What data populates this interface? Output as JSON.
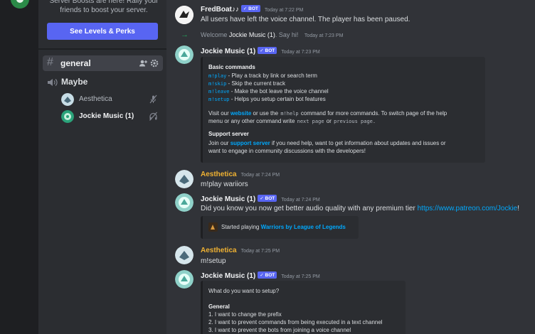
{
  "sidebar": {
    "boost_text_line1": "Server Boosts are here! Rally your",
    "boost_text_line2": "friends to boost your server.",
    "boost_button": "See Levels & Perks",
    "text_channel": "general",
    "voice_channel": "Maybe",
    "voice_users": [
      {
        "name": "Aesthetica",
        "color": "#b5bac1"
      },
      {
        "name": "Jockie Music (1)",
        "color": "#f2f3f5"
      }
    ]
  },
  "chat": {
    "bot_tag": "✓ BOT",
    "fredboat": {
      "name": "FredBoat♪♪",
      "time": "Today at 7:22 PM",
      "text": "All users have left the voice channel. The player has been paused."
    },
    "join": {
      "prefix": "Welcome",
      "name": "Jockie Music (1)",
      "suffix": ". Say hi!",
      "time": "Today at 7:23 PM"
    },
    "jockie1": {
      "name": "Jockie Music (1)",
      "time": "Today at 7:23 PM",
      "basic_title": "Basic commands",
      "cmds": [
        {
          "code": "m!play",
          "desc": " - Play a track by link or search term"
        },
        {
          "code": "m!skip",
          "desc": " - Skip the current track"
        },
        {
          "code": "m!leave",
          "desc": " - Make the bot leave the voice channel"
        },
        {
          "code": "m!setup",
          "desc": " - Helps you setup certain bot features"
        }
      ],
      "visit_a": "Visit our ",
      "visit_link": "website",
      "visit_b": " or use the ",
      "visit_code": "m!help",
      "visit_c": " command for more commands. To switch page of the help",
      "visit2_a": "menu or any other command write ",
      "visit2_code1": "next page",
      "visit2_b": " or ",
      "visit2_code2": "previous page",
      "visit2_c": ".",
      "support_title": "Support server",
      "support_a": "Join our ",
      "support_link": "support server",
      "support_b": " if you need help, want to get information about updates and issues or",
      "support2": "want to engage in community discussions with the developers!"
    },
    "aesthetica1": {
      "name": "Aesthetica",
      "time": "Today at 7:24 PM",
      "text": "m!play wariiors"
    },
    "jockie2": {
      "name": "Jockie Music (1)",
      "time": "Today at 7:24 PM",
      "text": "Did you know you now get better audio quality with any premium tier ",
      "link": "https://www.patreon.com/Jockie",
      "after": "!",
      "embed_a": "Started playing ",
      "embed_link": "Warriors by League of Legends"
    },
    "aesthetica2": {
      "name": "Aesthetica",
      "time": "Today at 7:25 PM",
      "text": "m!setup"
    },
    "jockie3": {
      "name": "Jockie Music (1)",
      "time": "Today at 7:25 PM",
      "q": "What do you want to setup?",
      "general": "General",
      "opts": [
        "1. I want to change the prefix",
        "2. I want to prevent commands from being executed in a text channel",
        "3. I want to prevent the bots from joining a voice channel"
      ]
    }
  },
  "colors": {
    "aesthetica": "#f0b232",
    "blurple": "#5865f2",
    "link": "#00a8fc"
  }
}
